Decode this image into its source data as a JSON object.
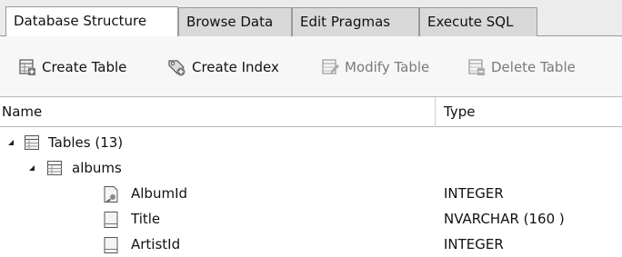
{
  "tabs": [
    {
      "label": "Database Structure",
      "active": true
    },
    {
      "label": "Browse Data",
      "active": false
    },
    {
      "label": "Edit Pragmas",
      "active": false
    },
    {
      "label": "Execute SQL",
      "active": false
    }
  ],
  "toolbar": {
    "create_table": {
      "label": "Create Table",
      "icon": "create-table-icon",
      "enabled": true
    },
    "create_index": {
      "label": "Create Index",
      "icon": "create-index-icon",
      "enabled": true
    },
    "modify_table": {
      "label": "Modify Table",
      "icon": "modify-table-icon",
      "enabled": false
    },
    "delete_table": {
      "label": "Delete Table",
      "icon": "delete-table-icon",
      "enabled": false
    }
  },
  "tree": {
    "columns": {
      "name": "Name",
      "type": "Type"
    },
    "tables_node": {
      "label": "Tables (13)",
      "expanded": true,
      "icon": "tables-folder-icon"
    },
    "albums_node": {
      "label": "albums",
      "expanded": true,
      "icon": "table-icon"
    },
    "fields": [
      {
        "name": "AlbumId",
        "type": "INTEGER",
        "icon": "primary-key-field-icon"
      },
      {
        "name": "Title",
        "type": "NVARCHAR (160 )",
        "icon": "field-icon"
      },
      {
        "name": "ArtistId",
        "type": "INTEGER",
        "icon": "field-icon"
      }
    ]
  },
  "colors": {
    "tab_inactive": "#d9d9d9",
    "tab_active": "#ffffff",
    "toolbar_bg": "#f7f7f7",
    "disabled_text": "#7a7a7a"
  }
}
